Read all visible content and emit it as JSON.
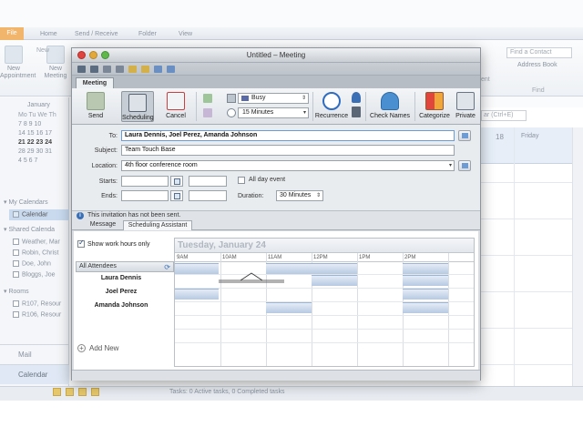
{
  "bg": {
    "orb": "File",
    "tabs": [
      "Home",
      "Send / Receive",
      "Folder",
      "View"
    ],
    "new_appointment": "New Appointment",
    "new_meeting": "New Meeting",
    "group_new": "New",
    "find_contact": "Find a Contact",
    "address_book": "Address Book",
    "find_label": "Find",
    "ribbon_partial": "ent",
    "search_placeholder": "ar (Ctrl+E)",
    "day_number": "18",
    "day_name": "Friday",
    "status": "Tasks: 0 Active tasks, 0 Completed tasks",
    "nav_mail": "Mail",
    "nav_calendar": "Calendar",
    "mini_cal": {
      "month": "January",
      "header": "Mo Tu We Th",
      "rows": [
        "7  8  9 10",
        "14 15 16 17",
        "21 22 23 24",
        "28 29 30 31",
        "4  5  6  7"
      ]
    },
    "my_calendars": "My Calendars",
    "calendar_item": "Calendar",
    "shared_calendars": "Shared Calenda",
    "shared_items": [
      "Weather, Mar",
      "Robin, Christ",
      "Doe, John",
      "Bloggs, Joe"
    ],
    "rooms": "Rooms",
    "room_items": [
      "R107, Resour",
      "R106, Resour"
    ]
  },
  "window": {
    "title": "Untitled – Meeting",
    "tab": "Meeting",
    "ribbon": {
      "send": "Send",
      "scheduling": "Scheduling",
      "cancel": "Cancel",
      "show_as": "Busy",
      "reminder": "15 Minutes",
      "recurrence": "Recurrence",
      "check_names": "Check Names",
      "categorize": "Categorize",
      "private": "Private"
    },
    "form": {
      "to_label": "To:",
      "to_value": "Laura Dennis, Joel Perez, Amanda Johnson",
      "subject_label": "Subject:",
      "subject_value": "Team Touch Base",
      "location_label": "Location:",
      "location_value": "4th floor conference room",
      "starts_label": "Starts:",
      "ends_label": "Ends:",
      "all_day": "All day event",
      "duration_label": "Duration:",
      "duration_value": "30 Minutes"
    },
    "info": "This invitation has not been sent.",
    "subtabs": [
      "Message",
      "Scheduling Assistant"
    ],
    "sched": {
      "show_work_hours": "Show work hours only",
      "date": "Tuesday, January 24",
      "all_attendees": "All Attendees",
      "attendees": [
        "Laura Dennis",
        "Joel Perez",
        "Amanda Johnson"
      ],
      "hours": [
        "9AM",
        "10AM",
        "11AM",
        "12PM",
        "1PM",
        "2PM"
      ],
      "add_new": "Add New"
    }
  }
}
